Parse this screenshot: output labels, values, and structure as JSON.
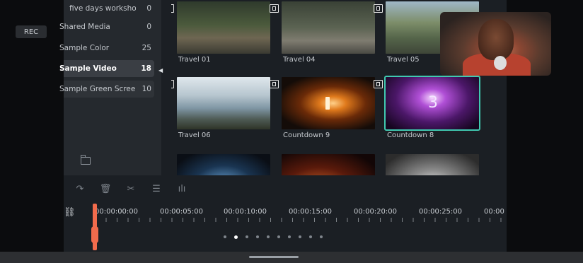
{
  "recording": {
    "label": "REC"
  },
  "library": {
    "items": [
      {
        "name": "five days workshop",
        "count": "0"
      },
      {
        "name": "Shared Media",
        "count": "0"
      },
      {
        "name": "Sample Color",
        "count": "25"
      },
      {
        "name": "Sample Video",
        "count": "18",
        "active": true
      },
      {
        "name": "Sample Green Screen",
        "count": "10"
      }
    ]
  },
  "media": {
    "clips": [
      {
        "title": "Travel 01"
      },
      {
        "title": "Travel 04"
      },
      {
        "title": "Travel 05"
      },
      {
        "title": "Travel 06"
      },
      {
        "title": "Countdown 9",
        "digit": "1"
      },
      {
        "title": "Countdown 8",
        "digit": "3",
        "selected": true
      }
    ]
  },
  "timeline": {
    "timecodes": [
      "00:00:00:00",
      "00:00:05:00",
      "00:00:10:00",
      "00:00:15:00",
      "00:00:20:00",
      "00:00:25:00",
      "00:00"
    ]
  },
  "pagination": {
    "total_dots": 10,
    "active_index": 1
  },
  "colors": {
    "accent_selected": "#40c9b0",
    "playhead": "#f26b4c"
  }
}
